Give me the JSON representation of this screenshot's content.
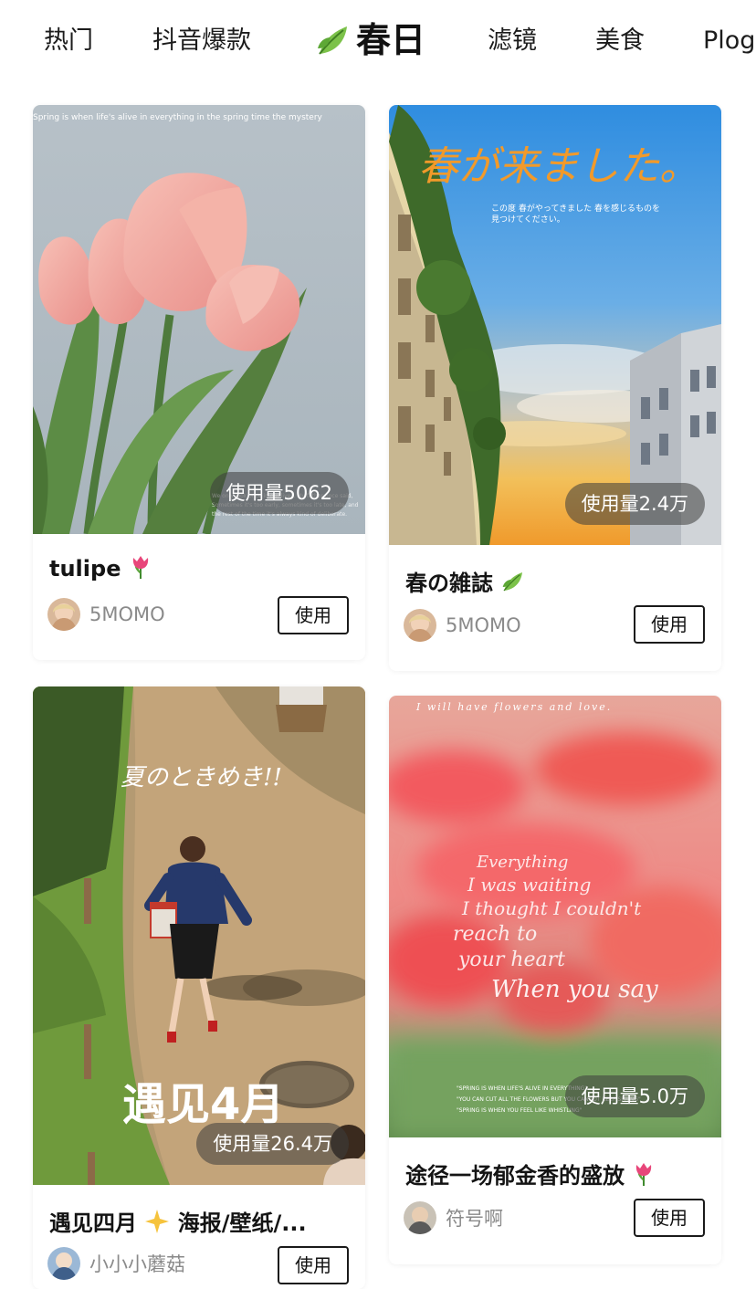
{
  "tabs": [
    {
      "label": "热门",
      "active": false
    },
    {
      "label": "抖音爆款",
      "active": false
    },
    {
      "label": "春日",
      "active": true,
      "icon": "leaf-icon"
    },
    {
      "label": "滤镜",
      "active": false
    },
    {
      "label": "美食",
      "active": false
    },
    {
      "label": "Plog",
      "active": false
    }
  ],
  "cards": [
    {
      "usage": "使用量5062",
      "title": "tulipe",
      "title_emoji": "tulip-icon",
      "author": "5MOMO",
      "use_label": "使用",
      "overlay_text": "Spring   is   when   life's   alive   in everything   in   the   spring   time  the  mystery"
    },
    {
      "usage": "使用量2.4万",
      "title": "春の雑誌",
      "title_emoji": "leaf-icon",
      "author": "5MOMO",
      "use_label": "使用",
      "overlay_text": "春が来ました。"
    },
    {
      "usage": "使用量26.4万",
      "title": "遇见四月",
      "title_rest": "海报/壁纸/...",
      "title_emoji": "sparkle-icon",
      "author": "小小小蘑菇",
      "use_label": "使用",
      "overlay_text": "夏のときめき!!",
      "overlay_text2": "遇见4月"
    },
    {
      "usage": "使用量5.0万",
      "title": "途径一场郁金香的盛放",
      "title_emoji": "tulip-icon",
      "author": "符号啊",
      "use_label": "使用",
      "overlay_text": "I  will  have  flowers  and  love.",
      "overlay_text2": "When you say"
    }
  ],
  "colors": {
    "accent_leaf": "#6cb43f",
    "tulip_pink": "#f0a3a0",
    "usage_badge": "rgba(60,60,60,0.55)"
  }
}
